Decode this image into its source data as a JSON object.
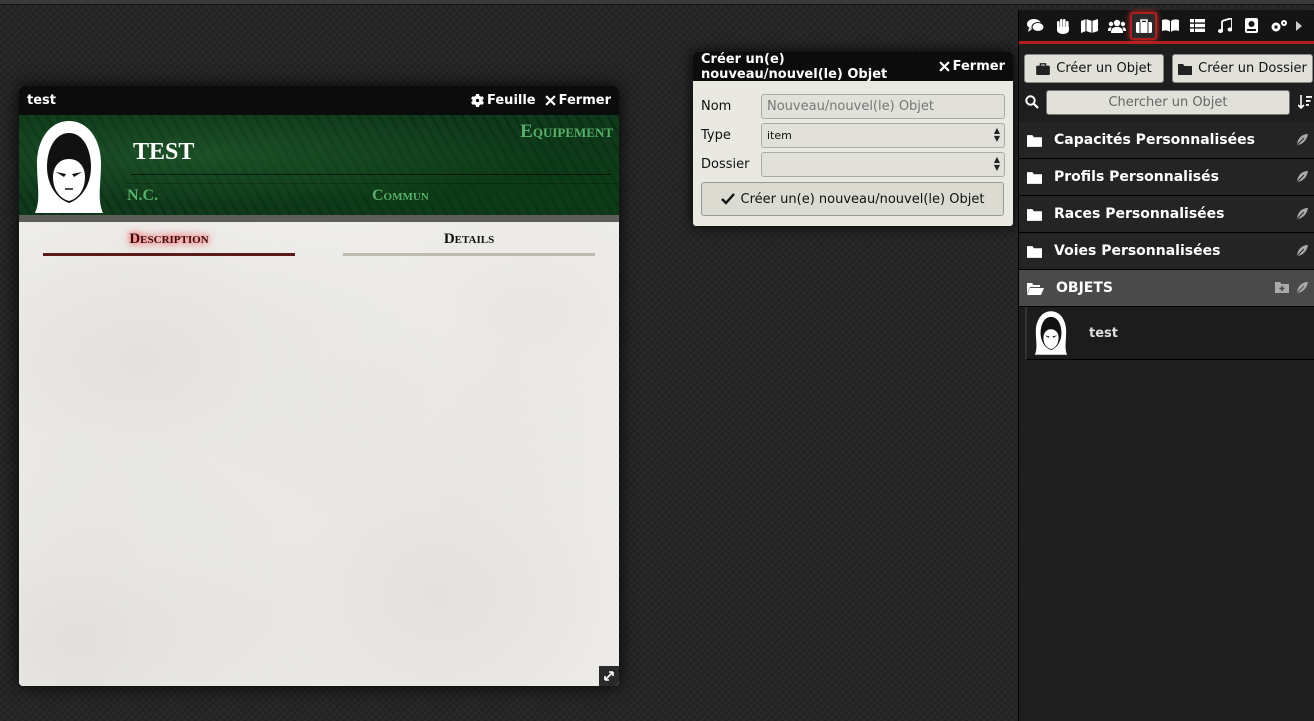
{
  "sheet": {
    "window_title": "test",
    "sheet_button": "Feuille",
    "close_button": "Fermer",
    "item_name": "TEST",
    "category_label": "Equipement",
    "field_left": "N.C.",
    "field_right": "Commun",
    "tabs": [
      {
        "label": "Description",
        "active": true
      },
      {
        "label": "Details",
        "active": false
      }
    ]
  },
  "dialog": {
    "title": "Créer un(e) nouveau/nouvel(le) Objet",
    "close_button": "Fermer",
    "name_label": "Nom",
    "name_placeholder": "Nouveau/nouvel(le) Objet",
    "type_label": "Type",
    "type_value": "item",
    "folder_label": "Dossier",
    "folder_value": "",
    "submit_label": "Créer un(e) nouveau/nouvel(le) Objet"
  },
  "sidebar": {
    "tabs": [
      "chat-icon",
      "hand-icon",
      "map-icon",
      "users-icon",
      "suitcase-icon",
      "book-open-icon",
      "table-icon",
      "music-icon",
      "compendium-icon",
      "settings-icon"
    ],
    "active_tab": "suitcase-icon",
    "create_item_button": "Créer un Objet",
    "create_folder_button": "Créer un Dossier",
    "search_placeholder": "Chercher un Objet",
    "folders": [
      {
        "label": "Capacités Personnalisées"
      },
      {
        "label": "Profils Personnalisés"
      },
      {
        "label": "Races Personnalisées"
      },
      {
        "label": "Voies Personnalisées"
      }
    ],
    "open_folder": "OBJETS",
    "entries": [
      {
        "label": "test"
      }
    ]
  },
  "colors": {
    "accent_red": "#b01e1e",
    "banner_green": "#0f3a1b",
    "label_green": "#58b06a"
  }
}
